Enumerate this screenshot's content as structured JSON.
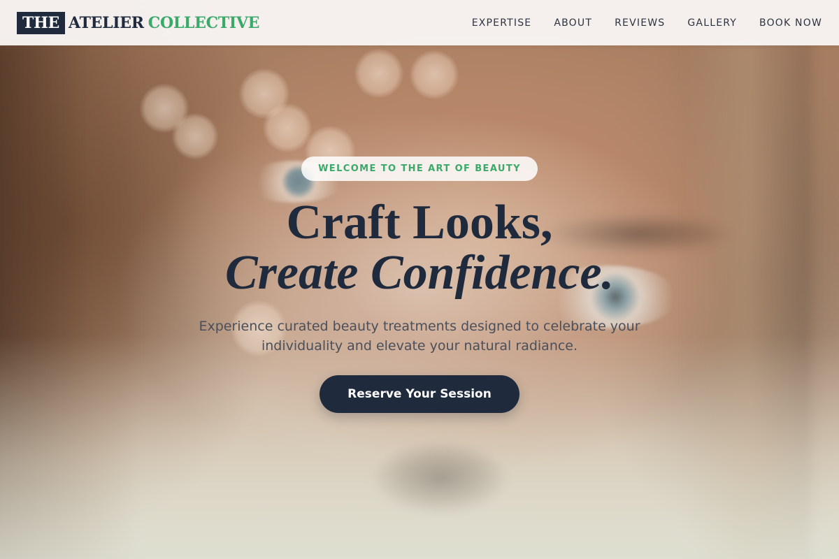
{
  "brand": {
    "the": "THE",
    "atelier": "ATELIER",
    "collective": "COLLECTIVE"
  },
  "nav": {
    "items": [
      "EXPERTISE",
      "ABOUT",
      "REVIEWS",
      "GALLERY",
      "BOOK NOW"
    ]
  },
  "hero": {
    "badge": "WELCOME TO THE ART OF BEAUTY",
    "headline_line1": "Craft Looks,",
    "headline_line2": "Create Confidence.",
    "subtext": "Experience curated beauty treatments designed to celebrate your individuality and elevate your natural radiance.",
    "cta_label": "Reserve Your Session"
  },
  "colors": {
    "brand_navy": "#1f2a3d",
    "brand_green": "#3aa96a",
    "header_bg": "#faf8f6"
  }
}
